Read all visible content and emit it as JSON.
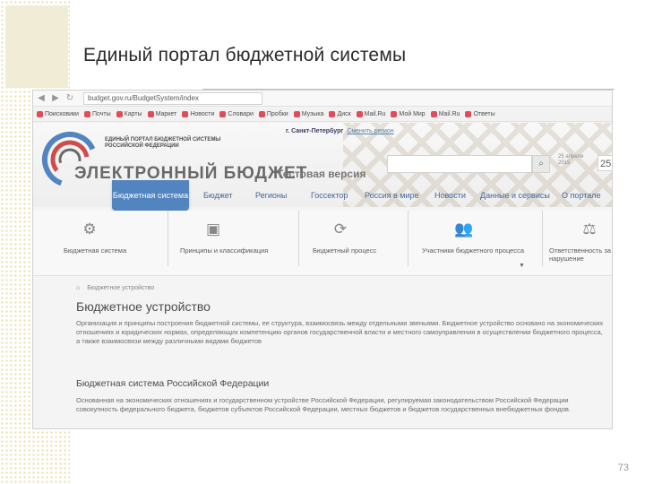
{
  "slide": {
    "title": "Единый портал бюджетной системы",
    "page_number": "73"
  },
  "browser": {
    "url": "budget.gov.ru/BudgetSystem/index",
    "bookmarks": [
      "Поисковики",
      "Почты",
      "Карты",
      "Маркет",
      "Новости",
      "Словари",
      "Пробки",
      "Музыка",
      "Диск",
      "Mail.Ru",
      "Мой Мир",
      "Mail.Ru",
      "Ответы"
    ]
  },
  "header": {
    "logo_subtitle": "ЕДИНЫЙ ПОРТАЛ БЮДЖЕТНОЙ СИСТЕМЫ РОССИЙСКОЙ ФЕДЕРАЦИИ",
    "logo_main": "ЭЛЕКТРОННЫЙ БЮДЖЕТ",
    "test_version": "Тестовая версия",
    "city": "г. Санкт-Петербург",
    "city_link": "Сменить регион",
    "date_label": "25 апреля 2015",
    "date_num": "25"
  },
  "menu": {
    "active": "Бюджетная система",
    "items": [
      "Бюджет",
      "Регионы",
      "Госсектор",
      "Россия в мире",
      "Новости",
      "Данные и сервисы",
      "О портале"
    ]
  },
  "tiles": [
    {
      "label": "Бюджетная система",
      "icon": "gears-icon"
    },
    {
      "label": "Принципы и классификация",
      "icon": "box-icon"
    },
    {
      "label": "Бюджетный процесс",
      "icon": "cycle-icon"
    },
    {
      "label": "Участники бюджетного процесса",
      "icon": "people-icon"
    },
    {
      "label": "Ответственность за нарушение законодательства",
      "icon": "gavel-icon"
    }
  ],
  "content": {
    "breadcrumb": "Бюджетное устройство",
    "heading": "Бюджетное устройство",
    "paragraph1": "Организация и принципы построения бюджетной системы, ее структура, взаимосвязь между отдельными звеньями. Бюджетное устройство основано на экономических отношениях и юридических нормах, определяющих компетенцию органов государственной власти и местного самоуправления в осуществлении бюджетного процесса, а также взаимосвязи между различными видами бюджетов",
    "subheading": "Бюджетная система Российской Федерации",
    "paragraph2": "Основанная на экономических отношениях и государственном устройстве Российской Федерации, регулируемая законодательством Российской Федерации совокупность федерального бюджета, бюджетов субъектов Российской Федерации, местных бюджетов и бюджетов государственных внебюджетных фондов."
  }
}
